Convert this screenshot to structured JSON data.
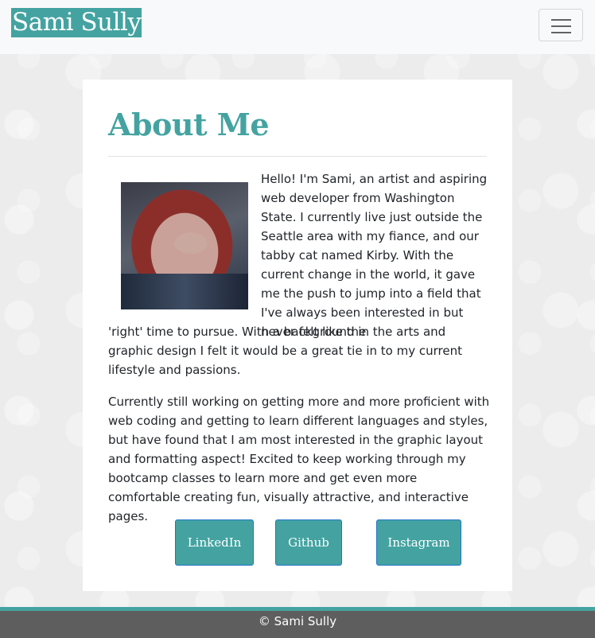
{
  "navbar": {
    "brand": "Sami Sully",
    "toggler_icon": "hamburger-menu-icon"
  },
  "about": {
    "title": "About Me",
    "photo_icon": "profile-photo",
    "paragraph1_beside_photo": "Hello! I'm Sami, an artist and aspiring web developer from Washington State. I currently live just outside the Seattle area with my fiance, and our tabby cat named Kirby. With the current change in the world, it gave me the push to jump into a field that I've always been interested in but never felt like the",
    "paragraph1_below_photo": "'right' time to pursue. With a background in the arts and graphic design I felt it would be a great tie in to my current lifestyle and passions.",
    "paragraph2": "Currently still working on getting more and more proficient with web coding and getting to learn different languages and styles, but have found that I am most interested in the graphic layout and formatting aspect! Excited to keep working through my bootcamp classes to learn more and get even more comfortable creating fun, visually attractive, and interactive pages."
  },
  "links": {
    "linkedin": "LinkedIn",
    "github": "Github",
    "instagram": "Instagram"
  },
  "footer": {
    "text": "© Sami Sully"
  },
  "colors": {
    "accent": "#44a3a1",
    "footer_bg": "#5e5e5e",
    "navbar_bg": "#f8f9fa"
  }
}
